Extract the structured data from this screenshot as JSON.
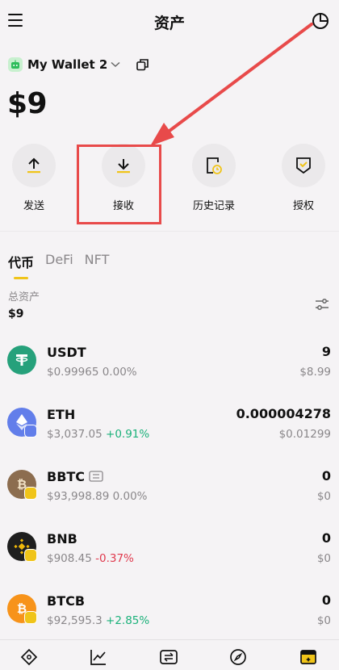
{
  "header": {
    "title": "资产"
  },
  "wallet": {
    "name": "My Wallet 2",
    "balance": "$9"
  },
  "actions": [
    {
      "label": "发送",
      "icon": "arrow-up-icon"
    },
    {
      "label": "接收",
      "icon": "arrow-down-icon"
    },
    {
      "label": "历史记录",
      "icon": "history-icon"
    },
    {
      "label": "授权",
      "icon": "shield-check-icon"
    }
  ],
  "tabs": [
    "代币",
    "DeFi",
    "NFT"
  ],
  "summary": {
    "label": "总资产",
    "value": "$9"
  },
  "tokens": [
    {
      "symbol": "USDT",
      "price": "$0.99965",
      "change": "0.00%",
      "change_dir": "flat",
      "amount": "9",
      "value": "$8.99",
      "color": "#26a17b"
    },
    {
      "symbol": "ETH",
      "price": "$3,037.05",
      "change": "+0.91%",
      "change_dir": "up",
      "amount": "0.000004278",
      "value": "$0.01299",
      "color": "#627eea"
    },
    {
      "symbol": "BBTC",
      "price": "$93,998.89",
      "change": "0.00%",
      "change_dir": "flat",
      "amount": "0",
      "value": "$0",
      "color": "#8c6d4f"
    },
    {
      "symbol": "BNB",
      "price": "$908.45",
      "change": "-0.37%",
      "change_dir": "down",
      "amount": "0",
      "value": "$0",
      "color": "#1e1e1e"
    },
    {
      "symbol": "BTCB",
      "price": "$92,595.3",
      "change": "+2.85%",
      "change_dir": "up",
      "amount": "0",
      "value": "$0",
      "color": "#f7931a"
    }
  ],
  "colors": {
    "up": "#1bb17a",
    "down": "#e0394d",
    "highlight": "#e84a4a",
    "accent": "#f0c419"
  }
}
